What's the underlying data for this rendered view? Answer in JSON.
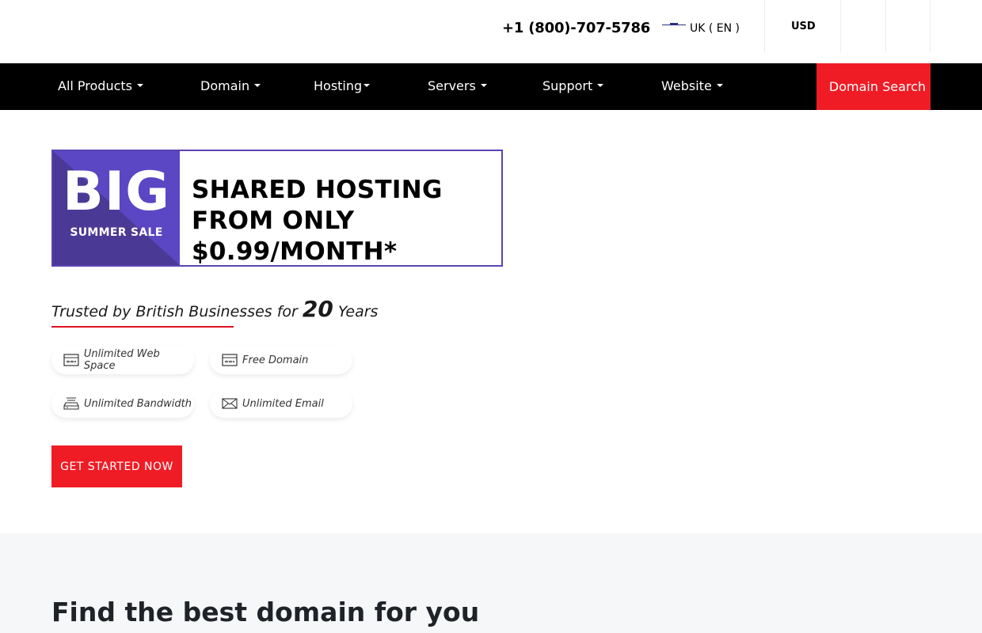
{
  "topbar": {
    "phone": "+1 (800)-707-5786",
    "language": "UK ( EN )",
    "currency": "USD"
  },
  "nav": {
    "items": [
      {
        "label": "All Products"
      },
      {
        "label": "Domain"
      },
      {
        "label": "Hosting"
      },
      {
        "label": "Servers"
      },
      {
        "label": "Support"
      },
      {
        "label": "Website"
      }
    ],
    "domain_search": "Domain Search"
  },
  "banner": {
    "big": "BIG",
    "summer_sale": "SUMMER SALE",
    "headline": "SHARED HOSTING FROM ONLY $0.99/MONTH*"
  },
  "trusted": {
    "prefix": "Trusted by British Businesses for ",
    "number": "20",
    "suffix": " Years"
  },
  "features": [
    {
      "label": "Unlimited Web Space",
      "icon": "server-icon"
    },
    {
      "label": "Free Domain",
      "icon": "server-icon"
    },
    {
      "label": "Unlimited Bandwidth",
      "icon": "router-icon"
    },
    {
      "label": "Unlimited Email",
      "icon": "envelope-icon"
    }
  ],
  "cta": "GET STARTED NOW",
  "domain_section": {
    "title": "Find the best domain for you"
  },
  "colors": {
    "accent_red": "#ef1c25",
    "banner_purple": "#5b46c4",
    "nav_black": "#000000"
  }
}
